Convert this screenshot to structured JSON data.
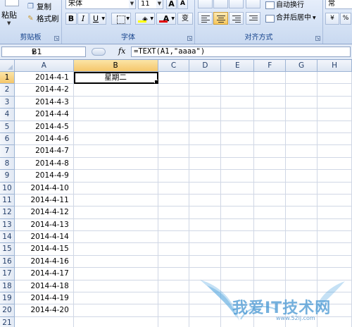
{
  "ribbon": {
    "clipboard": {
      "paste_label": "粘贴",
      "copy_label": "复制",
      "format_painter_label": "格式刷",
      "group_label": "剪贴板"
    },
    "font": {
      "font_name": "宋体",
      "font_size": "11",
      "bold": "B",
      "italic": "I",
      "underline": "U",
      "grow_font": "A",
      "shrink_font": "A",
      "font_color": "A",
      "phonetic": "变",
      "group_label": "字体"
    },
    "alignment": {
      "wrap_text_label": "自动换行",
      "merge_center_label": "合并后居中",
      "group_label": "对齐方式"
    },
    "number": {
      "partial_label": "常"
    }
  },
  "formula_bar": {
    "name_box": "B1",
    "fx": "fx",
    "formula": "=TEXT(A1,\"aaaa\")"
  },
  "sheet": {
    "columns": [
      "A",
      "B",
      "C",
      "D",
      "E",
      "F",
      "G",
      "H"
    ],
    "active_cell": "B1",
    "rows": [
      {
        "num": "1",
        "a": "2014-4-1",
        "b": "星期二"
      },
      {
        "num": "2",
        "a": "2014-4-2",
        "b": ""
      },
      {
        "num": "3",
        "a": "2014-4-3",
        "b": ""
      },
      {
        "num": "4",
        "a": "2014-4-4",
        "b": ""
      },
      {
        "num": "5",
        "a": "2014-4-5",
        "b": ""
      },
      {
        "num": "6",
        "a": "2014-4-6",
        "b": ""
      },
      {
        "num": "7",
        "a": "2014-4-7",
        "b": ""
      },
      {
        "num": "8",
        "a": "2014-4-8",
        "b": ""
      },
      {
        "num": "9",
        "a": "2014-4-9",
        "b": ""
      },
      {
        "num": "10",
        "a": "2014-4-10",
        "b": ""
      },
      {
        "num": "11",
        "a": "2014-4-11",
        "b": ""
      },
      {
        "num": "12",
        "a": "2014-4-12",
        "b": ""
      },
      {
        "num": "13",
        "a": "2014-4-13",
        "b": ""
      },
      {
        "num": "14",
        "a": "2014-4-14",
        "b": ""
      },
      {
        "num": "15",
        "a": "2014-4-15",
        "b": ""
      },
      {
        "num": "16",
        "a": "2014-4-16",
        "b": ""
      },
      {
        "num": "17",
        "a": "2014-4-17",
        "b": ""
      },
      {
        "num": "18",
        "a": "2014-4-18",
        "b": ""
      },
      {
        "num": "19",
        "a": "2014-4-19",
        "b": ""
      },
      {
        "num": "20",
        "a": "2014-4-20",
        "b": ""
      },
      {
        "num": "21",
        "a": "",
        "b": ""
      }
    ]
  },
  "watermark": {
    "text": "我爱IT技术网",
    "url": "www.52ij.com"
  },
  "colors": {
    "ribbon_bg": "#d5e2f5",
    "selection_header": "#f5c66a",
    "grid_line": "#d0d7e5"
  }
}
